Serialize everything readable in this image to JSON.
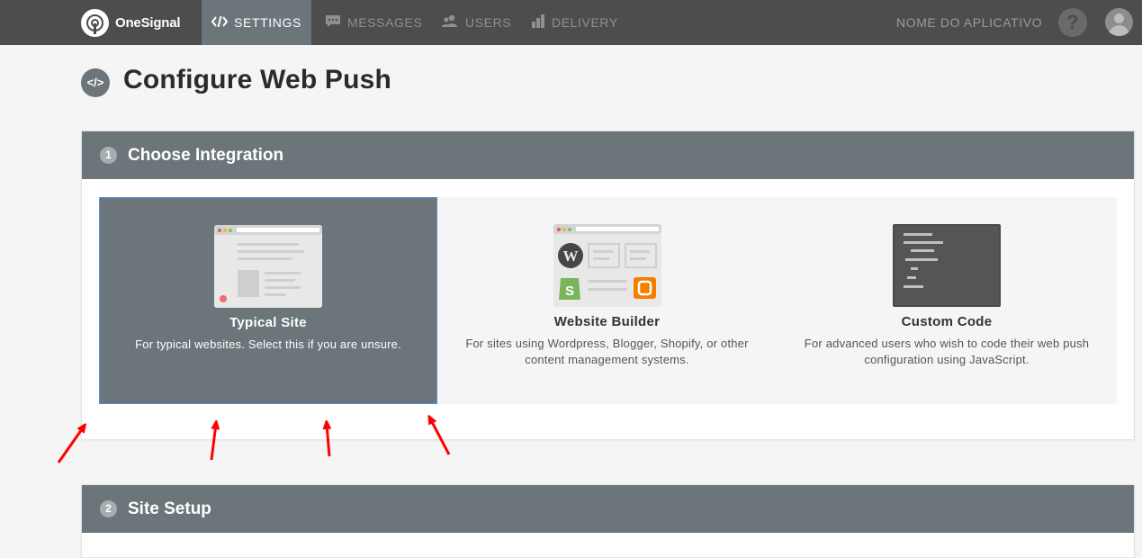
{
  "brand": {
    "name": "OneSignal"
  },
  "nav": {
    "settings": "SETTINGS",
    "messages": "MESSAGES",
    "users": "USERS",
    "delivery": "DELIVERY",
    "app_name": "NOME DO APLICATIVO",
    "help": "?"
  },
  "page": {
    "title": "Configure Web Push",
    "title_icon": "</>"
  },
  "section1": {
    "number": "1",
    "title": "Choose Integration",
    "options": [
      {
        "name": "Typical Site",
        "desc": "For typical websites. Select this if you are unsure.",
        "selected": true,
        "icon": "browser-page-icon"
      },
      {
        "name": "Website Builder",
        "desc": "For sites using Wordpress, Blogger, Shopify, or other content management systems.",
        "selected": false,
        "icon": "website-builder-icon"
      },
      {
        "name": "Custom Code",
        "desc": "For advanced users who wish to code their web push configuration using JavaScript.",
        "selected": false,
        "icon": "code-terminal-icon"
      }
    ]
  },
  "section2": {
    "number": "2",
    "title": "Site Setup"
  },
  "colors": {
    "topbar": "#4d4d4d",
    "header": "#6c757a",
    "selected_border": "#5b8fd8",
    "arrow": "#ff0000"
  }
}
